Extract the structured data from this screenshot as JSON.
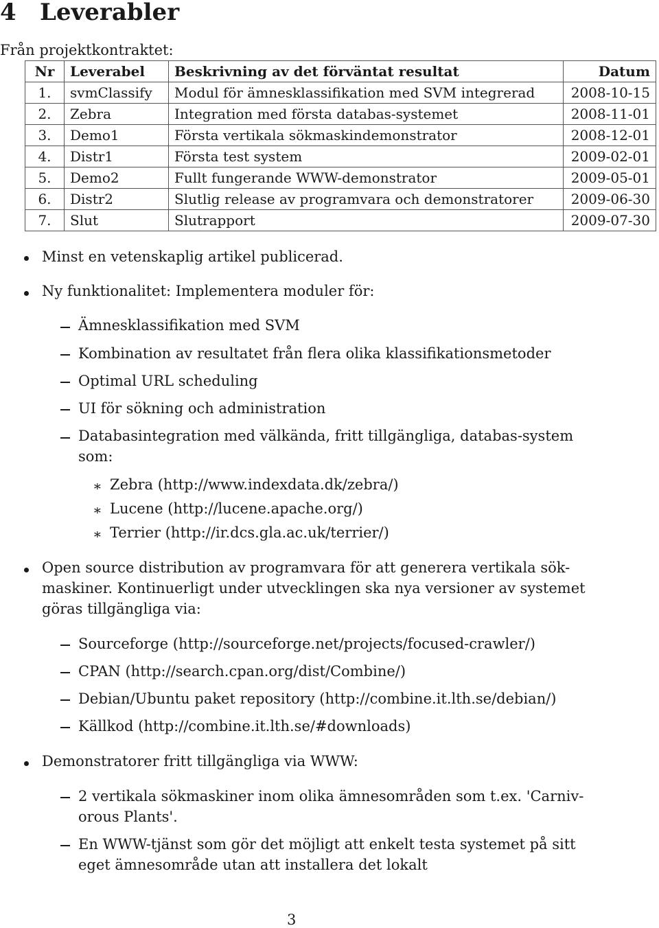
{
  "section": {
    "number": "4",
    "title": "Leverabler"
  },
  "intro": "Från projektkontraktet:",
  "table": {
    "headers": [
      "Nr",
      "Leverabel",
      "Beskrivning av det förväntat resultat",
      "Datum"
    ],
    "rows": [
      [
        "1.",
        "svmClassify",
        "Modul för ämnesklassifikation med SVM integrerad",
        "2008-10-15"
      ],
      [
        "2.",
        "Zebra",
        "Integration med första databas-systemet",
        "2008-11-01"
      ],
      [
        "3.",
        "Demo1",
        "Första vertikala sökmaskindemonstrator",
        "2008-12-01"
      ],
      [
        "4.",
        "Distr1",
        "Första test system",
        "2009-02-01"
      ],
      [
        "5.",
        "Demo2",
        "Fullt fungerande WWW-demonstrator",
        "2009-05-01"
      ],
      [
        "6.",
        "Distr2",
        "Slutlig release av programvara och demonstratorer",
        "2009-06-30"
      ],
      [
        "7.",
        "Slut",
        "Slutrapport",
        "2009-07-30"
      ]
    ]
  },
  "bullets": {
    "b1": "Minst en vetenskaplig artikel publicerad.",
    "b2": "Ny funktionalitet: Implementera moduler för:",
    "b2_items": [
      "Ämnesklassifikation med SVM",
      "Kombination av resultatet från flera olika klassifikationsmetoder",
      "Optimal URL scheduling",
      "UI för sökning och administration",
      "Databasintegration med välkända, fritt tillgängliga, databas-system",
      "som:"
    ],
    "b2_sub": [
      "Zebra (http://www.indexdata.dk/zebra/)",
      "Lucene (http://lucene.apache.org/)",
      "Terrier (http://ir.dcs.gla.ac.uk/terrier/)"
    ],
    "b3_lines": [
      "Open source distribution av programvara för att generera vertikala sök-",
      "maskiner. Kontinuerligt under utvecklingen ska nya versioner av systemet",
      "göras tillgängliga via:"
    ],
    "b3_items": [
      "Sourceforge (http://sourceforge.net/projects/focused-crawler/)",
      "CPAN (http://search.cpan.org/dist/Combine/)",
      "Debian/Ubuntu paket repository (http://combine.it.lth.se/debian/)",
      "Källkod (http://combine.it.lth.se/#downloads)"
    ],
    "b4": "Demonstratorer fritt tillgängliga via WWW:",
    "b4_items": [
      "2 vertikala sökmaskiner inom olika ämnesområden som t.ex. 'Carniv-",
      "orous Plants'.",
      "En WWW-tjänst som gör det möjligt att enkelt testa systemet på sitt",
      "eget ämnesområde utan att installera det lokalt"
    ]
  },
  "page_number": "3"
}
